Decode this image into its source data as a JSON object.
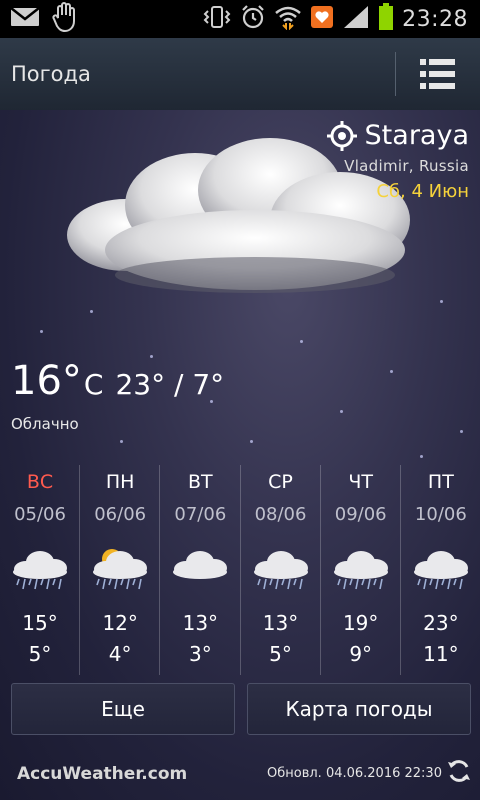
{
  "status_bar": {
    "time": "23:28",
    "left_icons": [
      "mail-icon",
      "hand-icon"
    ],
    "right_icons": [
      "vibrate-icon",
      "alarm-icon",
      "wifi-icon",
      "notification-app-icon",
      "signal-icon",
      "battery-icon"
    ]
  },
  "action_bar": {
    "title": "Погода",
    "menu_icon": "list-menu-icon"
  },
  "location": {
    "name": "Staraya",
    "region": "Vladimir, Russia",
    "date": "Сб, 4 Июн",
    "icon": "location-target-icon"
  },
  "current": {
    "temp": "16°",
    "unit": "C",
    "range": "23° / 7°",
    "condition": "Облачно",
    "icon": "cloud-icon"
  },
  "forecast": [
    {
      "day": "ВС",
      "date": "05/06",
      "high": "15°",
      "low": "5°",
      "icon": "rain-cloud-icon",
      "weekend": true
    },
    {
      "day": "ПН",
      "date": "06/06",
      "high": "12°",
      "low": "4°",
      "icon": "sun-rain-cloud-icon",
      "weekend": false
    },
    {
      "day": "ВТ",
      "date": "07/06",
      "high": "13°",
      "low": "3°",
      "icon": "cloud-icon",
      "weekend": false
    },
    {
      "day": "СР",
      "date": "08/06",
      "high": "13°",
      "low": "5°",
      "icon": "rain-cloud-icon",
      "weekend": false
    },
    {
      "day": "ЧТ",
      "date": "09/06",
      "high": "19°",
      "low": "9°",
      "icon": "rain-cloud-icon",
      "weekend": false
    },
    {
      "day": "ПТ",
      "date": "10/06",
      "high": "23°",
      "low": "11°",
      "icon": "rain-cloud-icon",
      "weekend": false
    }
  ],
  "buttons": {
    "more": "Еще",
    "map": "Карта погоды"
  },
  "footer": {
    "brand": "AccuWeather.com",
    "updated": "Обновл. 04.06.2016 22:30",
    "refresh_icon": "refresh-icon"
  },
  "colors": {
    "weekend": "#ff5a4e",
    "date_highlight": "#f5d23b",
    "battery": "#8fd400"
  }
}
